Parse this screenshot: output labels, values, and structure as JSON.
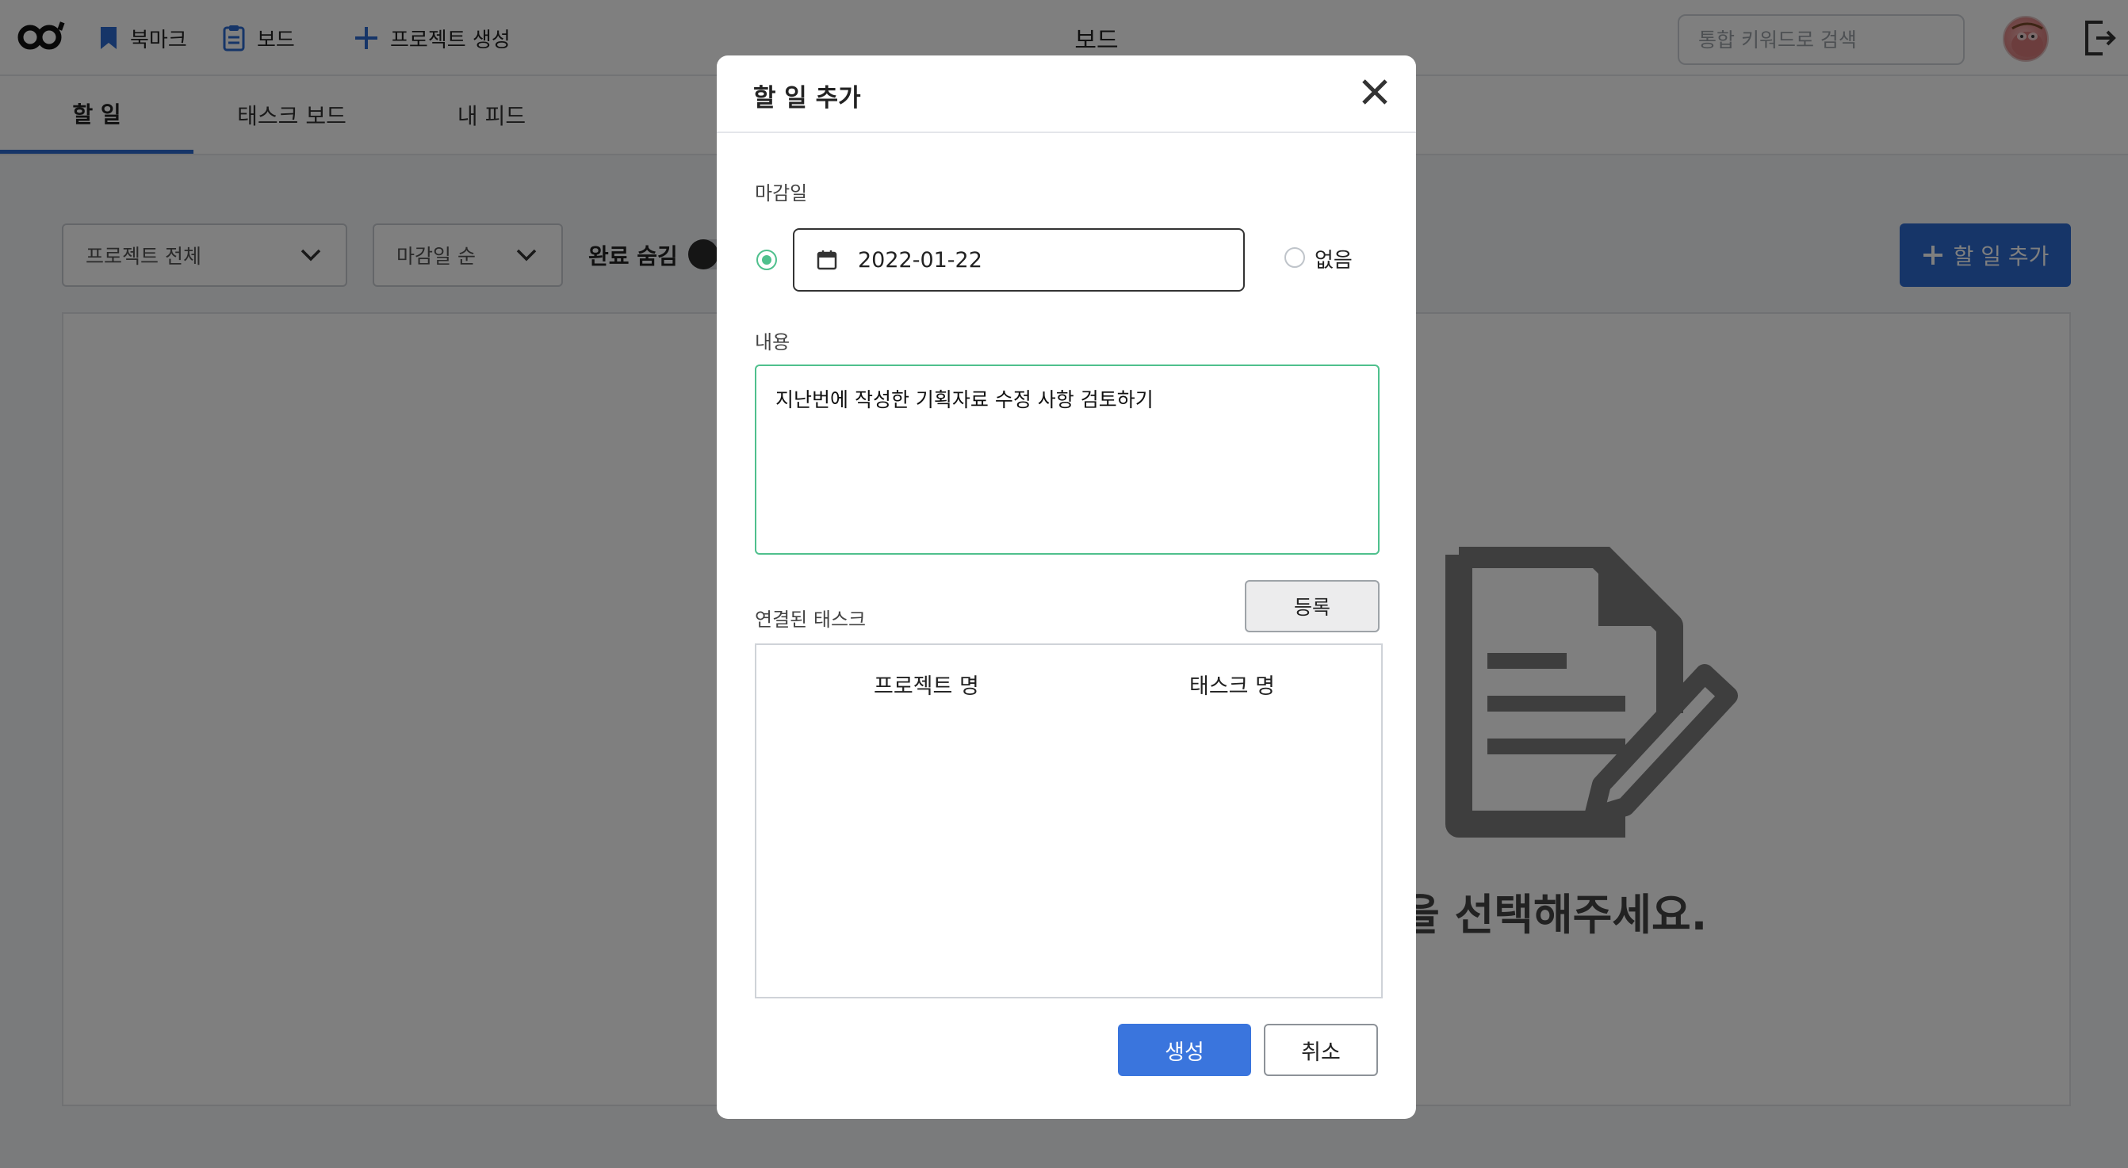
{
  "header": {
    "title": "보드",
    "nav": [
      {
        "label": "북마크",
        "icon": "bookmark-icon"
      },
      {
        "label": "보드",
        "icon": "clipboard-icon"
      },
      {
        "label": "프로젝트 생성",
        "icon": "plus-icon"
      }
    ],
    "search": {
      "placeholder": "통합 키워드로 검색",
      "value": ""
    }
  },
  "tabs": [
    {
      "label": "할 일",
      "active": true
    },
    {
      "label": "태스크 보드",
      "active": false
    },
    {
      "label": "내 피드",
      "active": false
    }
  ],
  "filters": {
    "project_select": "프로젝트 전체",
    "sort_select": "마감일 순",
    "hide_completed_label": "완료 숨김"
  },
  "add_todo_button": "할 일 추가",
  "empty_state": {
    "text": "항목을 선택해주세요."
  },
  "modal": {
    "title": "할 일 추가",
    "deadline_label": "마감일",
    "deadline_value": "2022-01-22",
    "deadline_none_label": "없음",
    "content_label": "내용",
    "content_value": "지난번에 작성한 기획자료 수정 사항 검토하기",
    "linked_tasks_label": "연결된 태스크",
    "register_button": "등록",
    "table_headers": [
      "프로젝트 명",
      "태스크 명"
    ],
    "create_button": "생성",
    "cancel_button": "취소"
  },
  "colors": {
    "accent": "#2d6bd1",
    "focus_green": "#4fc08d",
    "overlay": "rgba(0,0,0,0.5)"
  }
}
